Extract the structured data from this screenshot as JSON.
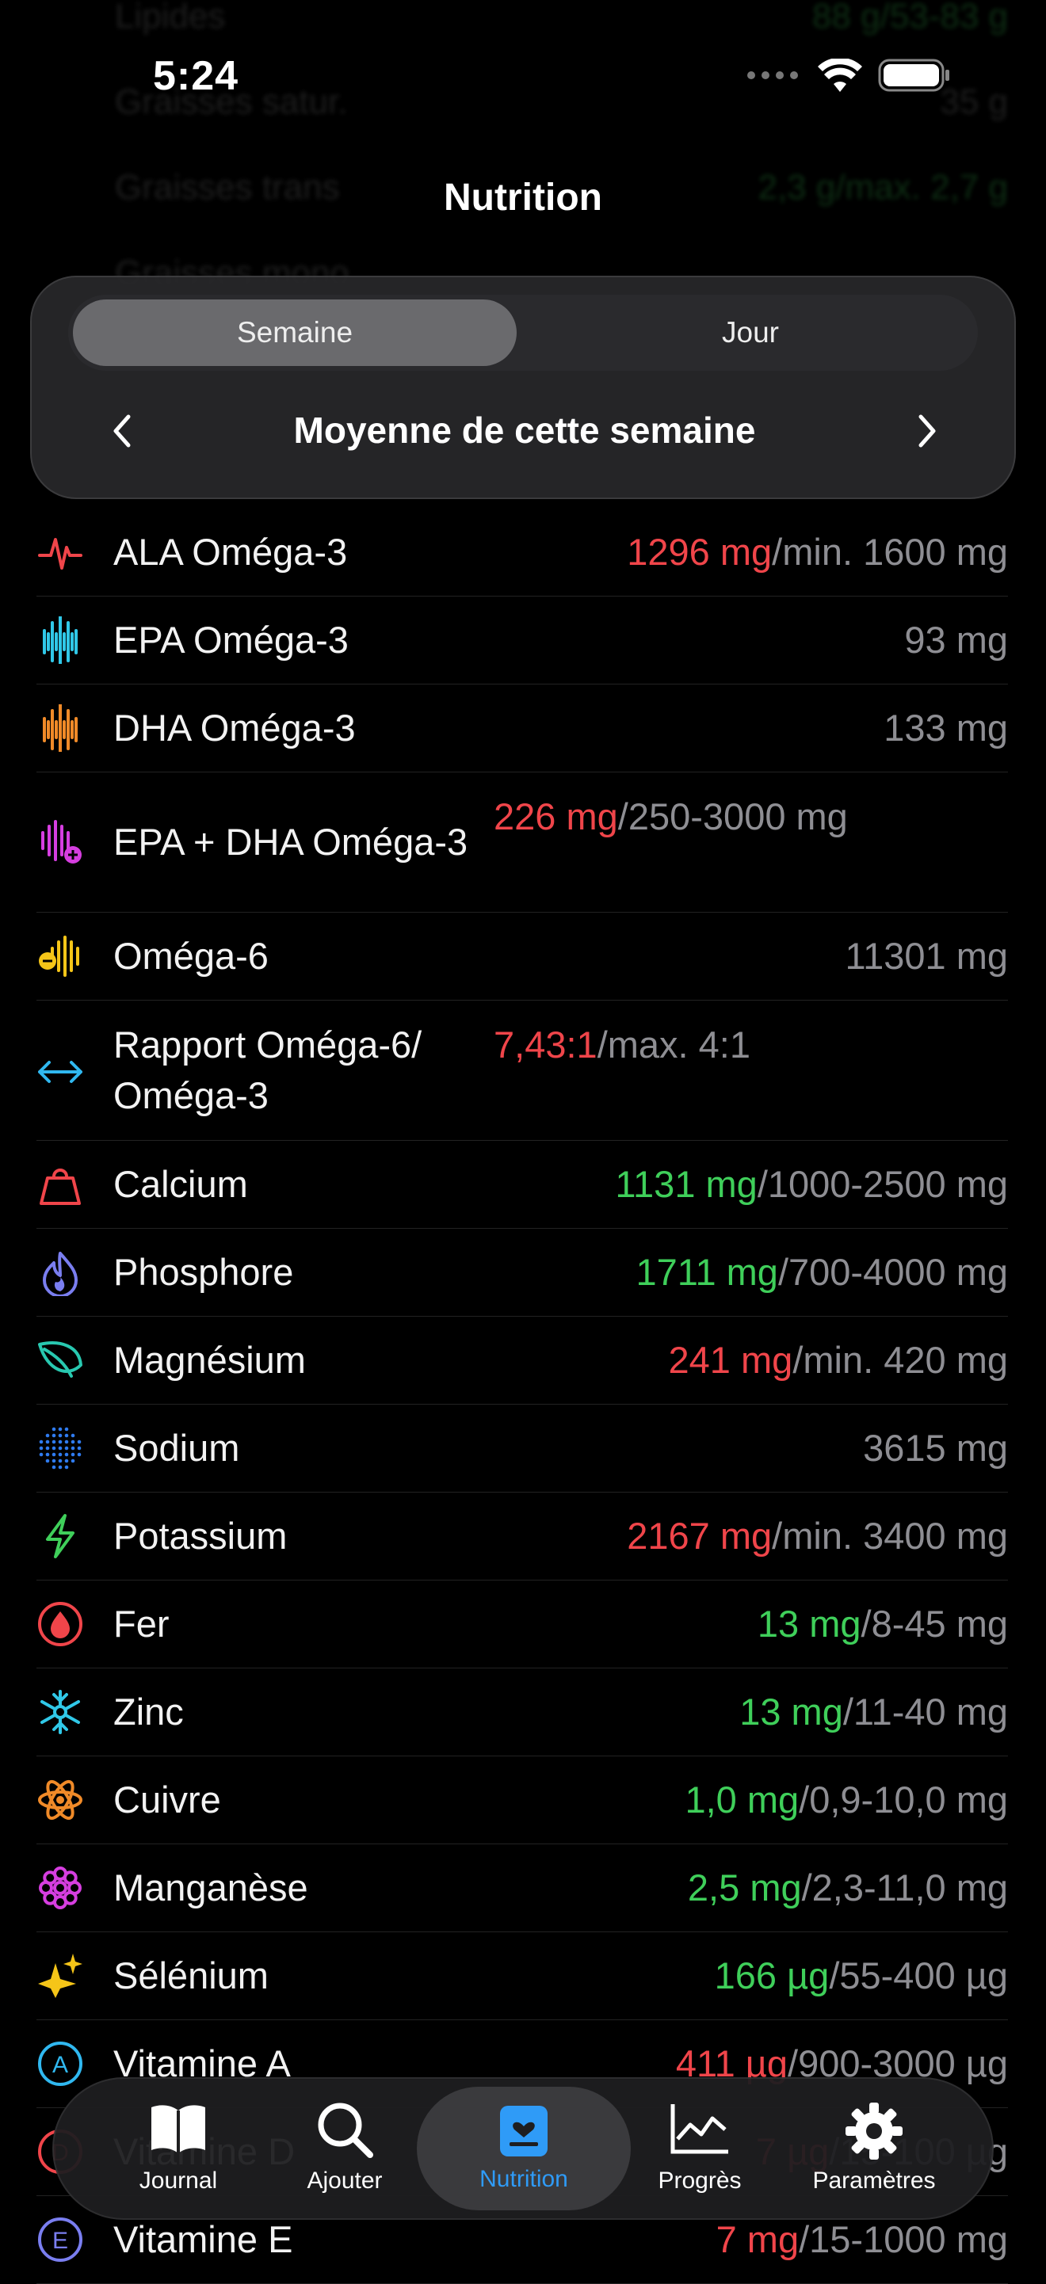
{
  "status_bar": {
    "time": "5:24"
  },
  "header": {
    "title": "Nutrition"
  },
  "background_rows": [
    {
      "name": "Lipides",
      "value": "88 g/53-83 g"
    },
    {
      "name": "Graisses satur.",
      "value": "35 g"
    },
    {
      "name": "Graisses trans",
      "value": "2,3 g/max. 2,7 g"
    },
    {
      "name": "Graisses mono",
      "value": ""
    }
  ],
  "segment": {
    "selected": "Semaine",
    "other": "Jour"
  },
  "period": {
    "label": "Moyenne de cette semaine"
  },
  "nutrients": [
    {
      "name": "ALA Oméga-3",
      "value": "1296 mg",
      "value_color": "red",
      "target": "min. 1600 mg",
      "icon": "waveform-pulse-icon",
      "icon_color": "#f0454a"
    },
    {
      "name": "EPA Oméga-3",
      "value": "",
      "value_color": "grey",
      "target": "93 mg",
      "icon": "waveform-icon",
      "icon_color": "#30c8e8"
    },
    {
      "name": "DHA Oméga-3",
      "value": "",
      "value_color": "grey",
      "target": "133 mg",
      "icon": "waveform-icon",
      "icon_color": "#f08a28"
    },
    {
      "name": "EPA + DHA Oméga-3",
      "value": "226 mg",
      "value_color": "red",
      "target": "250-3000 mg",
      "icon": "waveform-badge-plus-icon",
      "icon_color": "#d63ee0"
    },
    {
      "name": "Oméga-6",
      "value": "",
      "value_color": "grey",
      "target": "11301 mg",
      "icon": "waveform-badge-minus-icon",
      "icon_color": "#f5c518"
    },
    {
      "name": "Rapport Oméga-6/ Oméga-3",
      "value": "7,43:1",
      "value_color": "red",
      "target": "max. 4:1",
      "icon": "arrow-left-right-icon",
      "icon_color": "#30b8f0"
    },
    {
      "name": "Calcium",
      "value": "1131 mg",
      "value_color": "green",
      "target": "1000-2500 mg",
      "icon": "scale-weight-icon",
      "icon_color": "#f0454a"
    },
    {
      "name": "Phosphore",
      "value": "1711 mg",
      "value_color": "green",
      "target": "700-4000 mg",
      "icon": "flame-icon",
      "icon_color": "#7a7ef0"
    },
    {
      "name": "Magnésium",
      "value": "241 mg",
      "value_color": "red",
      "target": "min. 420 mg",
      "icon": "leaf-icon",
      "icon_color": "#28c8b0"
    },
    {
      "name": "Sodium",
      "value": "",
      "value_color": "grey",
      "target": "3615 mg",
      "icon": "dots-circle-icon",
      "icon_color": "#2f7bf0"
    },
    {
      "name": "Potassium",
      "value": "2167 mg",
      "value_color": "red",
      "target": "min. 3400 mg",
      "icon": "bolt-icon",
      "icon_color": "#3fcf5a"
    },
    {
      "name": "Fer",
      "value": "13 mg",
      "value_color": "green",
      "target": "8-45 mg",
      "icon": "drop-circle-icon",
      "icon_color": "#f0454a"
    },
    {
      "name": "Zinc",
      "value": "13 mg",
      "value_color": "green",
      "target": "11-40 mg",
      "icon": "snowflake-icon",
      "icon_color": "#30c8e8"
    },
    {
      "name": "Cuivre",
      "value": "1,0 mg",
      "value_color": "green",
      "target": "0,9-10,0 mg",
      "icon": "atom-icon",
      "icon_color": "#f08a28"
    },
    {
      "name": "Manganèse",
      "value": "2,5 mg",
      "value_color": "green",
      "target": "2,3-11,0 mg",
      "icon": "flower-icon",
      "icon_color": "#d63ee0"
    },
    {
      "name": "Sélénium",
      "value": "166 µg",
      "value_color": "green",
      "target": "55-400 µg",
      "icon": "sparkles-icon",
      "icon_color": "#f5c518"
    },
    {
      "name": "Vitamine A",
      "value": "411 µg",
      "value_color": "red",
      "target": "900-3000 µg",
      "icon": "letter-a-circle-icon",
      "icon_color": "#30b8f0"
    },
    {
      "name": "Vitamine D",
      "value": "7 µg",
      "value_color": "red",
      "target": "15-100 µg",
      "icon": "letter-d-circle-icon",
      "icon_color": "#f0454a"
    },
    {
      "name": "Vitamine E",
      "value": "7 mg",
      "value_color": "red",
      "target": "15-1000 mg",
      "icon": "letter-e-circle-icon",
      "icon_color": "#7a7ef0"
    }
  ],
  "tabbar": {
    "items": [
      {
        "label": "Journal",
        "icon": "book-icon"
      },
      {
        "label": "Ajouter",
        "icon": "magnifier-icon"
      },
      {
        "label": "Nutrition",
        "icon": "heart-document-icon",
        "active": true
      },
      {
        "label": "Progrès",
        "icon": "chart-line-icon"
      },
      {
        "label": "Paramètres",
        "icon": "gear-icon"
      }
    ]
  },
  "colors": {
    "red": "#f0454a",
    "green": "#3fcf5a",
    "grey": "#8e8e93",
    "accent": "#2f9bf7"
  }
}
